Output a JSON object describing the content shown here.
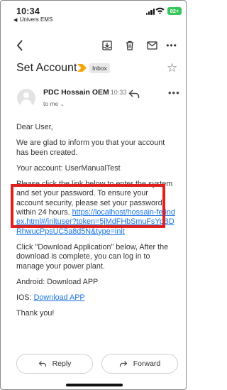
{
  "status_bar": {
    "time": "10:34",
    "back_app": "Univers EMS",
    "battery": "82+"
  },
  "toolbar": {
    "back_icon": "chevron-left-icon",
    "archive_icon": "archive-icon",
    "delete_icon": "trash-icon",
    "mail_icon": "mail-icon",
    "more_icon": "more-horizontal-icon"
  },
  "email": {
    "subject": "Set Account",
    "label_chip": "Inbox",
    "sender_name": "PDC Hossain OEM",
    "sent_time": "10:33",
    "recipient": "to me",
    "body": {
      "greeting": "Dear User,",
      "p1": "We are glad to inform you that your account has been created.",
      "p2": "Your account: UserManualTest",
      "p3_text": "Please click the link below to enter the system and set your password. To ensure your account security, please set your password within 24 hours.",
      "p3_link": "https://localhost/hossain-fe/index.html#/inituser?token=5jMdFHbSmuFsYpBDRhwucPpsUC5a8d5N&type=init",
      "p4": "Click \"Download Application\" below, After the download is complete, you can log in to manage your power plant.",
      "android_line": "Android: Download APP",
      "ios_label": "IOS: ",
      "ios_link": "Download APP",
      "thanks": "Thank you!"
    }
  },
  "actions": {
    "reply_label": "Reply",
    "forward_label": "Forward"
  },
  "colors": {
    "link": "#1a73e8",
    "highlight_box": "#e0201f",
    "importance_marker": "#f2a60c",
    "battery": "#34c759"
  }
}
